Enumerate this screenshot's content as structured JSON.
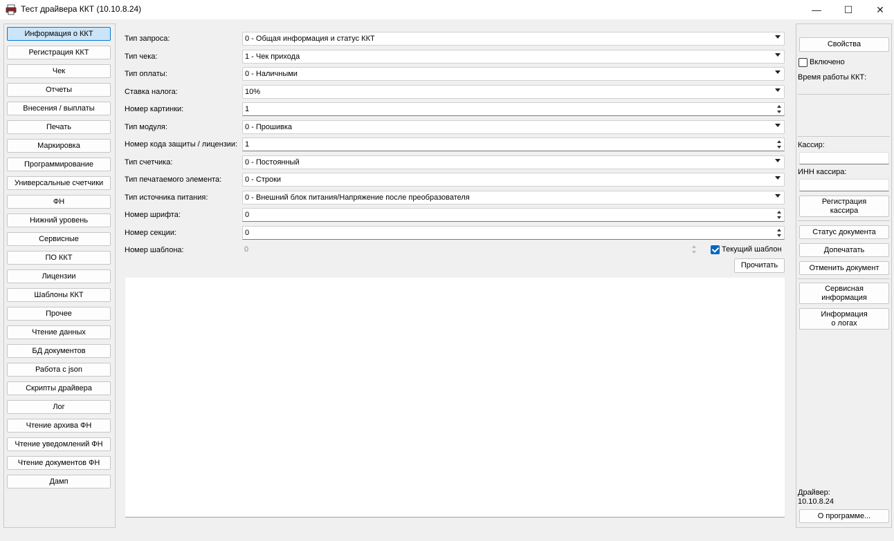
{
  "window": {
    "title": "Тест драйвера ККТ (10.10.8.24)",
    "minimize_glyph": "—",
    "maximize_glyph": "☐",
    "close_glyph": "✕"
  },
  "nav": [
    "Информация о ККТ",
    "Регистрация ККТ",
    "Чек",
    "Отчеты",
    "Внесения / выплаты",
    "Печать",
    "Маркировка",
    "Программирование",
    "Универсальные счетчики",
    "ФН",
    "Нижний уровень",
    "Сервисные",
    "ПО ККТ",
    "Лицензии",
    "Шаблоны ККТ",
    "Прочее",
    "Чтение данных",
    "БД документов",
    "Работа с json",
    "Скрипты драйвера",
    "Лог",
    "Чтение архива ФН",
    "Чтение уведомлений ФН",
    "Чтение документов ФН",
    "Дамп"
  ],
  "nav_active_index": 0,
  "form": [
    {
      "label": "Тип запроса:",
      "kind": "select",
      "value": "0 - Общая информация и статус ККТ"
    },
    {
      "label": "Тип чека:",
      "kind": "select",
      "value": "1 - Чек прихода"
    },
    {
      "label": "Тип оплаты:",
      "kind": "select",
      "value": "0 - Наличными"
    },
    {
      "label": "Ставка налога:",
      "kind": "select",
      "value": "10%"
    },
    {
      "label": "Номер картинки:",
      "kind": "spin",
      "value": "1"
    },
    {
      "label": "Тип модуля:",
      "kind": "select",
      "value": "0 - Прошивка"
    },
    {
      "label": "Номер кода защиты / лицензии:",
      "kind": "spin",
      "value": "1"
    },
    {
      "label": "Тип счетчика:",
      "kind": "select",
      "value": "0 - Постоянный"
    },
    {
      "label": "Тип печатаемого элемента:",
      "kind": "select",
      "value": "0 - Строки"
    },
    {
      "label": "Тип источника питания:",
      "kind": "select",
      "value": "0 - Внешний блок питания/Напряжение после преобразователя"
    },
    {
      "label": "Номер шрифта:",
      "kind": "spin",
      "value": "0"
    },
    {
      "label": "Номер секции:",
      "kind": "spin",
      "value": "0"
    },
    {
      "label": "Номер шаблона:",
      "kind": "spin-disabled",
      "value": "0"
    }
  ],
  "current_template": {
    "label": "Текущий шаблон",
    "checked": true
  },
  "read_button": "Прочитать",
  "output_text": "",
  "right": {
    "properties_button": "Свойства",
    "enabled_label": "Включено",
    "enabled_checked": false,
    "uptime_label": "Время работы ККТ:",
    "uptime_value": "",
    "cashier_label": "Кассир:",
    "cashier_value": "",
    "cashier_inn_label": "ИНН кассира:",
    "cashier_inn_value": "",
    "register_cashier_button": [
      "Регистрация",
      "кассира"
    ],
    "doc_status_button": "Статус документа",
    "reprint_button": "Допечатать",
    "cancel_doc_button": "Отменить документ",
    "service_info_button": [
      "Сервисная",
      "информация"
    ],
    "logs_info_button": [
      "Информация",
      "о логах"
    ],
    "driver_label": "Драйвер:",
    "driver_version": "10.10.8.24",
    "about_button": "О программе..."
  }
}
